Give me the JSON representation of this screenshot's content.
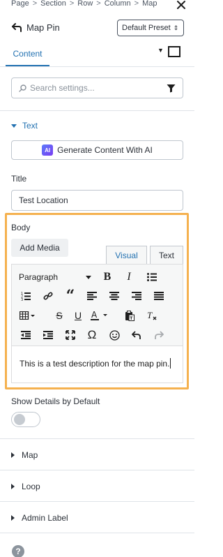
{
  "breadcrumb": {
    "items": [
      "Page",
      "Section",
      "Row",
      "Column",
      "Map"
    ],
    "separator": ">"
  },
  "header": {
    "title": "Map Pin",
    "preset_label": "Default Preset"
  },
  "tabs": {
    "content_label": "Content"
  },
  "search": {
    "placeholder": "Search settings..."
  },
  "text_group": {
    "label": "Text",
    "ai_badge": "AI",
    "ai_button_label": "Generate Content With AI"
  },
  "title_field": {
    "label": "Title",
    "value": "Test Location"
  },
  "body_field": {
    "label": "Body",
    "add_media_label": "Add Media",
    "tab_visual": "Visual",
    "tab_text": "Text",
    "format_value": "Paragraph",
    "content": "This is a test description for the map pin."
  },
  "toggle_field": {
    "label": "Show Details by Default",
    "on": false
  },
  "groups": [
    {
      "label": "Map"
    },
    {
      "label": "Loop"
    },
    {
      "label": "Admin Label"
    }
  ],
  "colors": {
    "accent": "#2271b1",
    "highlight": "#f5b14f"
  }
}
